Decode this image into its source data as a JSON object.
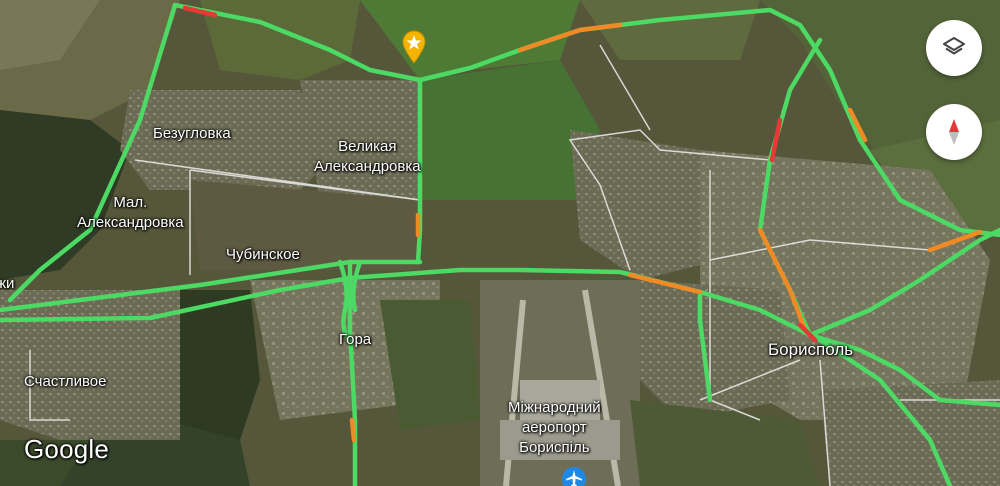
{
  "map": {
    "type": "satellite",
    "traffic_layer": true,
    "colors": {
      "traffic_fast": "#4cd964",
      "traffic_slow": "#f08a24",
      "traffic_jam": "#e53935",
      "local_road": "#e6e6e6",
      "pin_star": "#f4b400",
      "pin_airport": "#1e88e5",
      "compass_north": "#e53935",
      "compass_south": "#bdbdbd"
    }
  },
  "labels": {
    "bezuglovka": "Безугловка",
    "velikaya_aleksandrovka": "Великая\nАлександровка",
    "mal_aleksandrovka": "Мал.\nАлександровка",
    "chubinskoe": "Чубинское",
    "gora": "Гора",
    "boryspil": "Борисполь",
    "schastlivoe": "Счастливое",
    "airport": "Міжнародний\nаеропорт\nБориспіль",
    "edge_partial": "жи"
  },
  "controls": {
    "layers_icon": "layers-icon",
    "compass_icon": "compass-icon"
  },
  "branding": {
    "logo_text": "Google"
  },
  "pins": {
    "starred_place_icon": "star-icon",
    "airport_icon": "airplane-icon"
  }
}
